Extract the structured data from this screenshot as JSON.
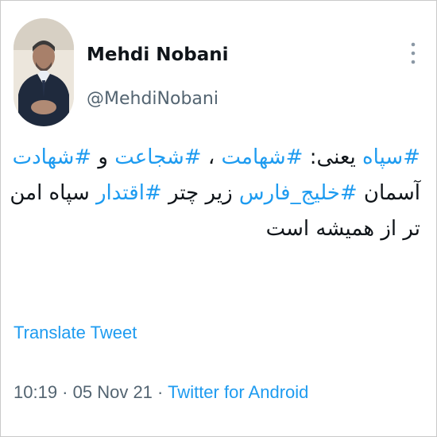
{
  "author": {
    "name": "Mehdi Nobani",
    "handle": "@MehdiNobani"
  },
  "tweet": {
    "lines": [
      [
        {
          "text": "#سپاه",
          "hashtag": true
        },
        {
          "text": " یعنی: ",
          "hashtag": false
        },
        {
          "text": "#شهامت",
          "hashtag": true
        },
        {
          "text": " ، ",
          "hashtag": false
        },
        {
          "text": "#شجاعت",
          "hashtag": true
        },
        {
          "text": " و ",
          "hashtag": false
        },
        {
          "text": "#شهادت",
          "hashtag": true
        }
      ],
      [
        {
          "text": "آسمان ",
          "hashtag": false
        },
        {
          "text": "#خلیج_فارس",
          "hashtag": true
        },
        {
          "text": " زیر چتر ",
          "hashtag": false
        },
        {
          "text": "#اقتدار",
          "hashtag": true
        },
        {
          "text": " سپاه امن",
          "hashtag": false
        }
      ],
      [
        {
          "text": "تر از همیشه است",
          "hashtag": false
        }
      ]
    ]
  },
  "actions": {
    "translate_label": "Translate Tweet"
  },
  "meta": {
    "time": "10:19",
    "separator": " · ",
    "date": "05 Nov 21",
    "source": "Twitter for Android"
  },
  "icons": {
    "more": "more-vertical-icon",
    "avatar": "profile-photo"
  },
  "colors": {
    "link": "#1d9bf0",
    "text": "#0f1419",
    "muted": "#536471"
  }
}
